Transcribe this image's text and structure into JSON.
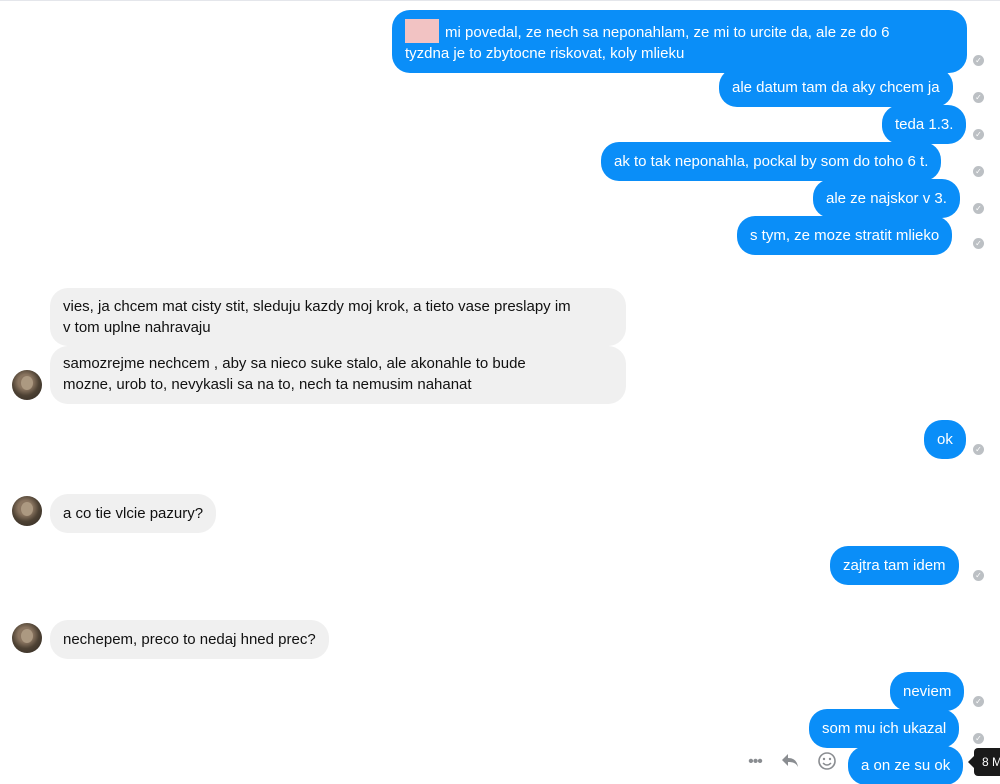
{
  "messages": {
    "m1": {
      "line1": "mi povedal, ze nech sa neponahlam, ze mi to urcite da, ale ze do 6",
      "line2": "tyzdna je to zbytocne riskovat, koly mlieku"
    },
    "m2": "ale datum tam da aky chcem ja",
    "m3": "teda 1.3.",
    "m4": "ak to tak neponahla, pockal by som do toho 6 t.",
    "m5": "ale ze najskor v 3.",
    "m6": "s tym, ze moze stratit mlieko",
    "m7": {
      "line1": "vies, ja chcem mat cisty stit, sleduju kazdy moj krok, a tieto vase preslapy im",
      "line2": "v tom uplne nahravaju"
    },
    "m8": {
      "line1": "samozrejme nechcem , aby sa nieco suke stalo, ale akonahle to bude",
      "line2": "mozne, urob to, nevykasli sa na to, nech ta nemusim nahanat"
    },
    "m9": "ok",
    "m10": "a co tie vlcie pazury?",
    "m11": "zajtra tam idem",
    "m12": "nechepem, preco to nedaj hned prec?",
    "m13": "neviem",
    "m14": "som mu ich ukazal",
    "m15": "a on ze su ok"
  },
  "tooltip": "8 M",
  "icons": {
    "more": "more-dots-icon",
    "reply": "reply-icon",
    "react": "emoji-react-icon",
    "seen": "seen-check-icon"
  },
  "colors": {
    "outgoing": "#0a8ef8",
    "incoming": "#f0f0f0"
  }
}
